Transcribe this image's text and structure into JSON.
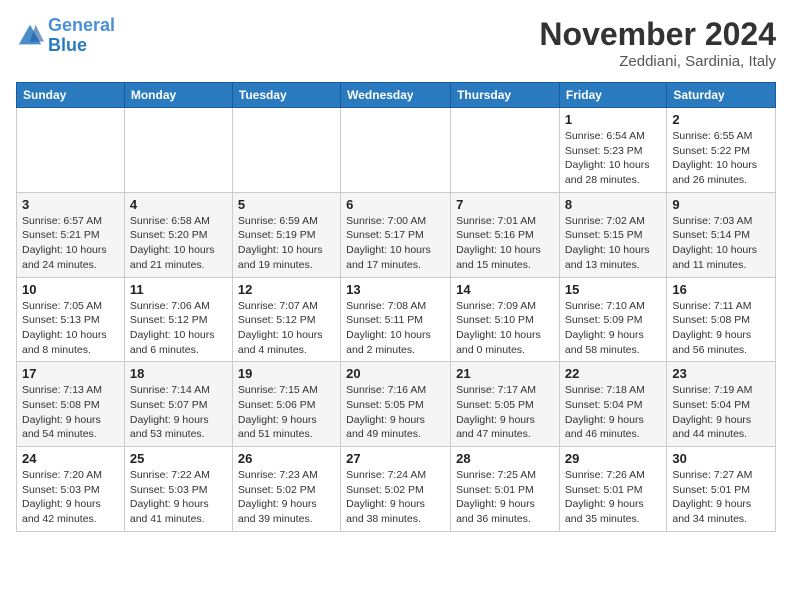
{
  "logo": {
    "line1": "General",
    "line2": "Blue"
  },
  "header": {
    "month": "November 2024",
    "location": "Zeddiani, Sardinia, Italy"
  },
  "weekdays": [
    "Sunday",
    "Monday",
    "Tuesday",
    "Wednesday",
    "Thursday",
    "Friday",
    "Saturday"
  ],
  "weeks": [
    [
      {
        "day": "",
        "info": ""
      },
      {
        "day": "",
        "info": ""
      },
      {
        "day": "",
        "info": ""
      },
      {
        "day": "",
        "info": ""
      },
      {
        "day": "",
        "info": ""
      },
      {
        "day": "1",
        "info": "Sunrise: 6:54 AM\nSunset: 5:23 PM\nDaylight: 10 hours and 28 minutes."
      },
      {
        "day": "2",
        "info": "Sunrise: 6:55 AM\nSunset: 5:22 PM\nDaylight: 10 hours and 26 minutes."
      }
    ],
    [
      {
        "day": "3",
        "info": "Sunrise: 6:57 AM\nSunset: 5:21 PM\nDaylight: 10 hours and 24 minutes."
      },
      {
        "day": "4",
        "info": "Sunrise: 6:58 AM\nSunset: 5:20 PM\nDaylight: 10 hours and 21 minutes."
      },
      {
        "day": "5",
        "info": "Sunrise: 6:59 AM\nSunset: 5:19 PM\nDaylight: 10 hours and 19 minutes."
      },
      {
        "day": "6",
        "info": "Sunrise: 7:00 AM\nSunset: 5:17 PM\nDaylight: 10 hours and 17 minutes."
      },
      {
        "day": "7",
        "info": "Sunrise: 7:01 AM\nSunset: 5:16 PM\nDaylight: 10 hours and 15 minutes."
      },
      {
        "day": "8",
        "info": "Sunrise: 7:02 AM\nSunset: 5:15 PM\nDaylight: 10 hours and 13 minutes."
      },
      {
        "day": "9",
        "info": "Sunrise: 7:03 AM\nSunset: 5:14 PM\nDaylight: 10 hours and 11 minutes."
      }
    ],
    [
      {
        "day": "10",
        "info": "Sunrise: 7:05 AM\nSunset: 5:13 PM\nDaylight: 10 hours and 8 minutes."
      },
      {
        "day": "11",
        "info": "Sunrise: 7:06 AM\nSunset: 5:12 PM\nDaylight: 10 hours and 6 minutes."
      },
      {
        "day": "12",
        "info": "Sunrise: 7:07 AM\nSunset: 5:12 PM\nDaylight: 10 hours and 4 minutes."
      },
      {
        "day": "13",
        "info": "Sunrise: 7:08 AM\nSunset: 5:11 PM\nDaylight: 10 hours and 2 minutes."
      },
      {
        "day": "14",
        "info": "Sunrise: 7:09 AM\nSunset: 5:10 PM\nDaylight: 10 hours and 0 minutes."
      },
      {
        "day": "15",
        "info": "Sunrise: 7:10 AM\nSunset: 5:09 PM\nDaylight: 9 hours and 58 minutes."
      },
      {
        "day": "16",
        "info": "Sunrise: 7:11 AM\nSunset: 5:08 PM\nDaylight: 9 hours and 56 minutes."
      }
    ],
    [
      {
        "day": "17",
        "info": "Sunrise: 7:13 AM\nSunset: 5:08 PM\nDaylight: 9 hours and 54 minutes."
      },
      {
        "day": "18",
        "info": "Sunrise: 7:14 AM\nSunset: 5:07 PM\nDaylight: 9 hours and 53 minutes."
      },
      {
        "day": "19",
        "info": "Sunrise: 7:15 AM\nSunset: 5:06 PM\nDaylight: 9 hours and 51 minutes."
      },
      {
        "day": "20",
        "info": "Sunrise: 7:16 AM\nSunset: 5:05 PM\nDaylight: 9 hours and 49 minutes."
      },
      {
        "day": "21",
        "info": "Sunrise: 7:17 AM\nSunset: 5:05 PM\nDaylight: 9 hours and 47 minutes."
      },
      {
        "day": "22",
        "info": "Sunrise: 7:18 AM\nSunset: 5:04 PM\nDaylight: 9 hours and 46 minutes."
      },
      {
        "day": "23",
        "info": "Sunrise: 7:19 AM\nSunset: 5:04 PM\nDaylight: 9 hours and 44 minutes."
      }
    ],
    [
      {
        "day": "24",
        "info": "Sunrise: 7:20 AM\nSunset: 5:03 PM\nDaylight: 9 hours and 42 minutes."
      },
      {
        "day": "25",
        "info": "Sunrise: 7:22 AM\nSunset: 5:03 PM\nDaylight: 9 hours and 41 minutes."
      },
      {
        "day": "26",
        "info": "Sunrise: 7:23 AM\nSunset: 5:02 PM\nDaylight: 9 hours and 39 minutes."
      },
      {
        "day": "27",
        "info": "Sunrise: 7:24 AM\nSunset: 5:02 PM\nDaylight: 9 hours and 38 minutes."
      },
      {
        "day": "28",
        "info": "Sunrise: 7:25 AM\nSunset: 5:01 PM\nDaylight: 9 hours and 36 minutes."
      },
      {
        "day": "29",
        "info": "Sunrise: 7:26 AM\nSunset: 5:01 PM\nDaylight: 9 hours and 35 minutes."
      },
      {
        "day": "30",
        "info": "Sunrise: 7:27 AM\nSunset: 5:01 PM\nDaylight: 9 hours and 34 minutes."
      }
    ]
  ]
}
